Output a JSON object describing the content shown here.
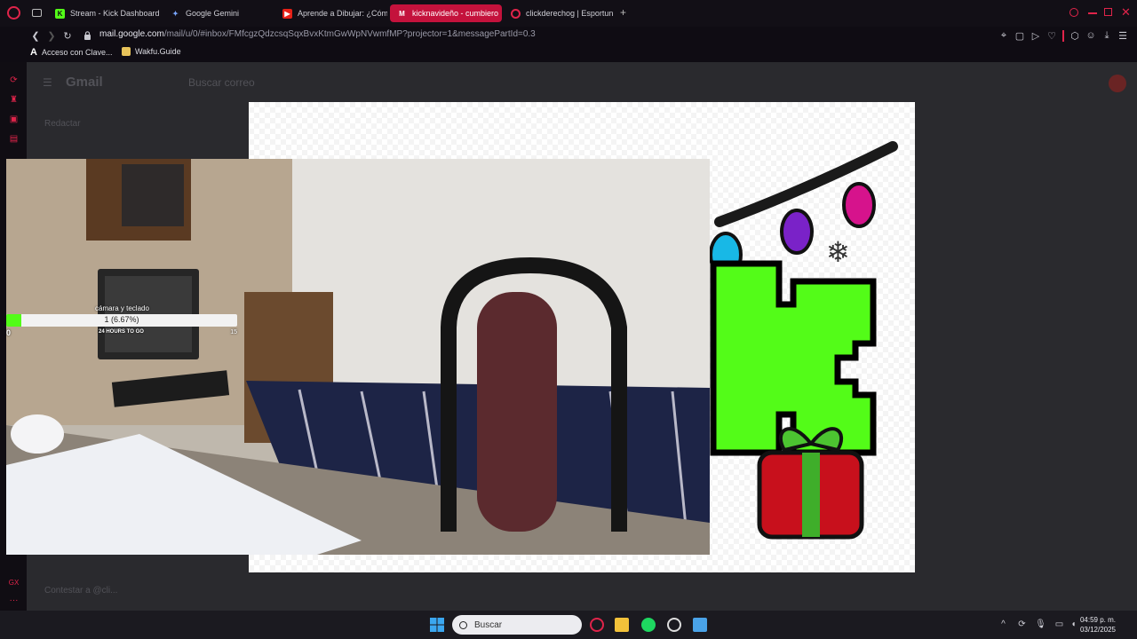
{
  "browser": {
    "tabs": [
      {
        "label": "Stream - Kick Dashboard",
        "icon": "kick-icon",
        "active": false
      },
      {
        "label": "Google Gemini",
        "icon": "gemini-icon",
        "active": false
      },
      {
        "label": "Aprende a Dibujar: ¿Cóm",
        "icon": "youtube-icon",
        "active": false
      },
      {
        "label": "kicknavideño - cumbiero",
        "icon": "gmail-icon",
        "active": true
      },
      {
        "label": "clickderechog | Esportun",
        "icon": "opera-gx-icon",
        "active": false
      }
    ],
    "url_host": "mail.google.com",
    "url_path": "/mail/u/0/#inbox/FMfcgzQdzcsqSqxBvxKtmGwWpNVwmfMP?projector=1&messagePartId=0.3",
    "bookmarks": [
      {
        "label": "Acceso con Clave...",
        "icon": "bookmark-a-icon"
      },
      {
        "label": "Wakfu.Guide",
        "icon": "wakfu-icon"
      }
    ]
  },
  "gmail_bg": {
    "app_name": "Gmail",
    "search_placeholder": "Buscar correo",
    "compose_label": "Redactar",
    "reply_placeholder": "Contestar a @cli..."
  },
  "stream_overlay": {
    "goal_title": "cámara y teclado",
    "goal_text": "1 (6.67%)",
    "goal_progress": 0.0667,
    "goal_min": "0",
    "goal_max": "15",
    "goal_sub": "24 HOURS TO GO"
  },
  "taskbar": {
    "search_label": "Buscar",
    "time": "04:59 p. m.",
    "date": "03/12/2025"
  },
  "colors": {
    "accent": "#c4123c",
    "kick_green": "#53fc18"
  }
}
